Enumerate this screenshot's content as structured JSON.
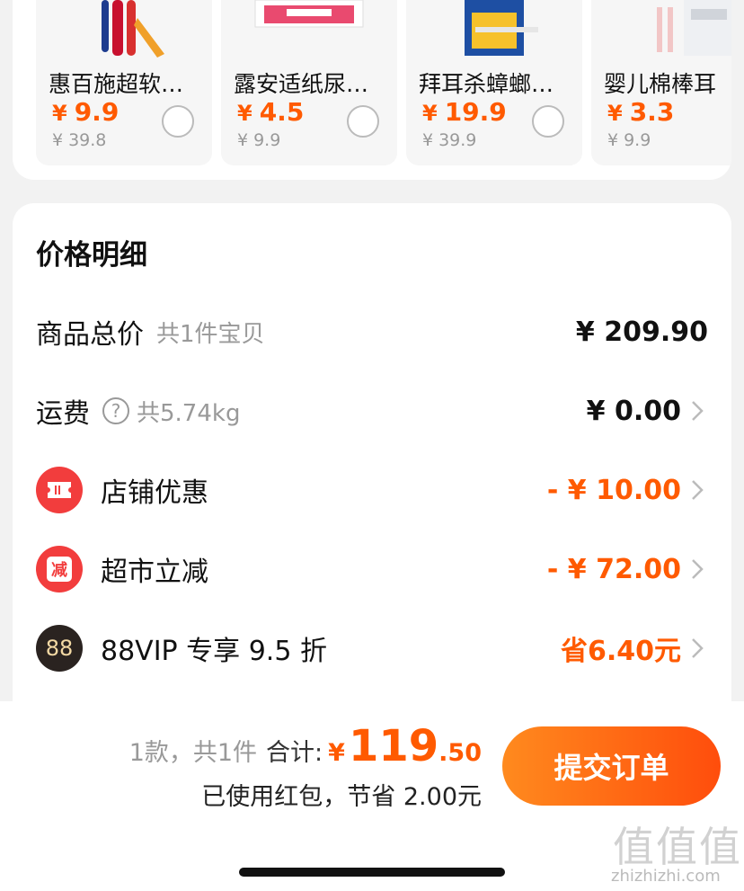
{
  "recommendations": [
    {
      "name": "惠百施超软…",
      "price": "9.9",
      "original": "39.8",
      "icon": "toothbrush-image"
    },
    {
      "name": "露安适纸尿…",
      "price": "4.5",
      "original": "9.9",
      "icon": "diaper-pack-image"
    },
    {
      "name": "拜耳杀蟑螂…",
      "price": "19.9",
      "original": "39.9",
      "icon": "cockroach-gel-image"
    },
    {
      "name": "婴儿棉棒耳",
      "price": "3.3",
      "original": "9.9",
      "icon": "cotton-swab-image"
    }
  ],
  "currency": "¥",
  "price_detail": {
    "title": "价格明细",
    "goods_total": {
      "label": "商品总价",
      "sub": "共1件宝贝",
      "amount": "¥ 209.90"
    },
    "shipping": {
      "label": "运费",
      "sub": "共5.74kg",
      "amount": "¥ 0.00"
    },
    "store_discount": {
      "label": "店铺优惠",
      "amount": "- ¥ 10.00",
      "icon": "ticket-icon"
    },
    "market_discount": {
      "label": "超市立减",
      "amount": "- ¥ 72.00",
      "icon": "discount-reduce-icon",
      "badge_text": "减"
    },
    "vip": {
      "label": "88VIP 专享 9.5 折",
      "amount": "省6.40元",
      "icon": "vip88-icon",
      "badge_text": "88"
    }
  },
  "footer": {
    "count": "1款，共1件",
    "total_label": "合计:",
    "total_currency": "¥",
    "total_int": "119",
    "total_dec": ".50",
    "redpacket_note": "已使用红包，节省 2.00元",
    "submit_label": "提交订单"
  },
  "watermark": {
    "glyphs": "值值值",
    "url": "zhizhizhi.com"
  },
  "colors": {
    "accent": "#ff5a00",
    "badge_red": "#f23d3d",
    "vip_dark": "#2a2320"
  }
}
